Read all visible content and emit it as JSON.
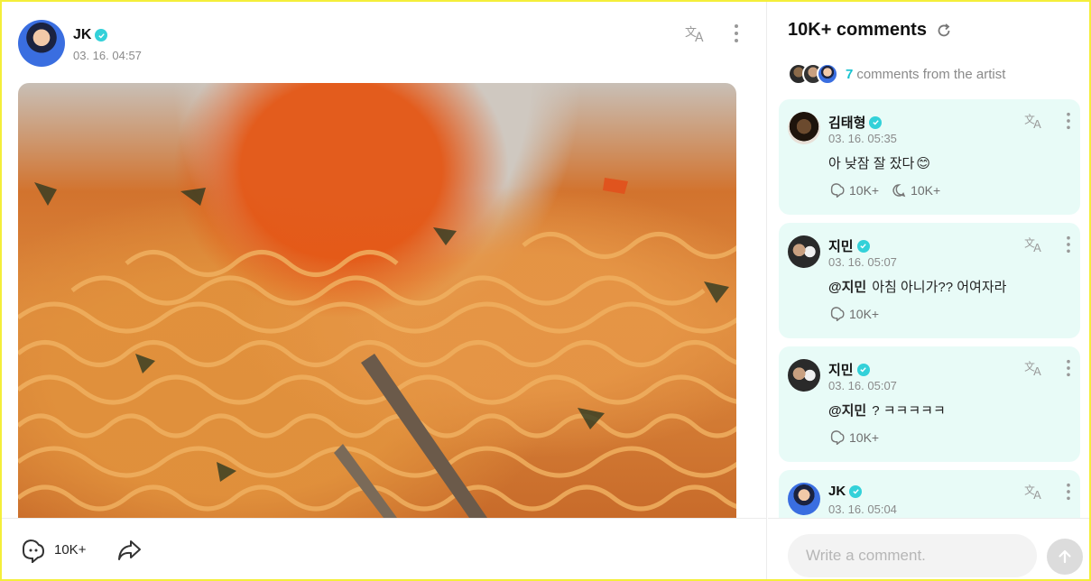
{
  "post": {
    "author": "JK",
    "date": "03. 16. 04:57",
    "like_count": "10K+",
    "photo_alt": "ramen-photo"
  },
  "comments_panel": {
    "title": "10K+ comments",
    "artist_count": "7",
    "artist_text": "comments from the artist",
    "input_placeholder": "Write a comment.",
    "items": [
      {
        "author": "김태형",
        "date": "03. 16. 05:35",
        "mention": "",
        "text": "아 낮잠 잘 잤다",
        "emoji": "😊",
        "likes": "10K+",
        "replies": "10K+"
      },
      {
        "author": "지민",
        "date": "03. 16. 05:07",
        "mention": "@지민",
        "text": "아침 아니가?? 어여자라",
        "emoji": "",
        "likes": "10K+",
        "replies": ""
      },
      {
        "author": "지민",
        "date": "03. 16. 05:07",
        "mention": "@지민",
        "text": "? ㅋㅋㅋㅋㅋ",
        "emoji": "",
        "likes": "10K+",
        "replies": ""
      },
      {
        "author": "JK",
        "date": "03. 16. 05:04",
        "mention": "",
        "text": "",
        "emoji": "",
        "likes": "",
        "replies": ""
      }
    ]
  },
  "colors": {
    "accent": "#33d1d9",
    "card_bg": "#e8fbf7",
    "frame": "#f4ee3a"
  },
  "icons": {
    "verified": "verified-badge-icon",
    "translate": "translate-icon",
    "more": "more-vertical-icon",
    "like": "like-icon",
    "share": "share-icon",
    "reply": "reply-icon",
    "refresh": "refresh-icon",
    "send": "send-arrow-icon"
  }
}
